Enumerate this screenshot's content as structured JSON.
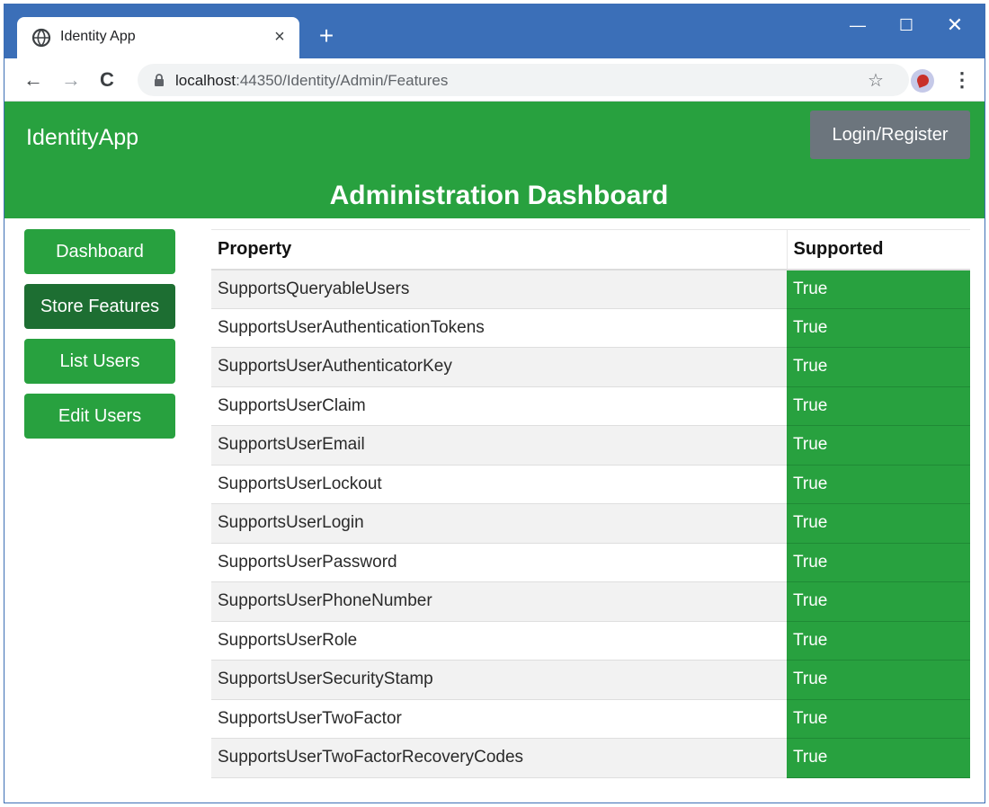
{
  "browser": {
    "tab_title": "Identity App",
    "tab_close": "×",
    "new_tab": "+",
    "controls": {
      "minimize": "—",
      "maximize": "☐",
      "close": "✕"
    },
    "nav": {
      "back": "←",
      "forward": "→",
      "reload": "C"
    },
    "url_host": "localhost",
    "url_path": ":44350/Identity/Admin/Features",
    "star": "☆",
    "menu": "⋮"
  },
  "app": {
    "brand": "IdentityApp",
    "login_label": "Login/Register",
    "title": "Administration Dashboard"
  },
  "sidebar": {
    "items": [
      {
        "label": "Dashboard",
        "active": false
      },
      {
        "label": "Store Features",
        "active": true
      },
      {
        "label": "List Users",
        "active": false
      },
      {
        "label": "Edit Users",
        "active": false
      }
    ]
  },
  "table": {
    "headers": [
      "Property",
      "Supported"
    ],
    "rows": [
      {
        "property": "SupportsQueryableUsers",
        "supported": "True"
      },
      {
        "property": "SupportsUserAuthenticationTokens",
        "supported": "True"
      },
      {
        "property": "SupportsUserAuthenticatorKey",
        "supported": "True"
      },
      {
        "property": "SupportsUserClaim",
        "supported": "True"
      },
      {
        "property": "SupportsUserEmail",
        "supported": "True"
      },
      {
        "property": "SupportsUserLockout",
        "supported": "True"
      },
      {
        "property": "SupportsUserLogin",
        "supported": "True"
      },
      {
        "property": "SupportsUserPassword",
        "supported": "True"
      },
      {
        "property": "SupportsUserPhoneNumber",
        "supported": "True"
      },
      {
        "property": "SupportsUserRole",
        "supported": "True"
      },
      {
        "property": "SupportsUserSecurityStamp",
        "supported": "True"
      },
      {
        "property": "SupportsUserTwoFactor",
        "supported": "True"
      },
      {
        "property": "SupportsUserTwoFactorRecoveryCodes",
        "supported": "True"
      }
    ]
  },
  "colors": {
    "brand_green": "#28a13f",
    "active_green": "#1d6e32",
    "login_gray": "#6c757d",
    "titlebar_blue": "#3b6fb8"
  },
  "icons": {
    "tab": "globe-icon",
    "lock": "lock-icon",
    "star": "star-icon",
    "profile": "profile-avatar-icon",
    "menu": "kebab-menu-icon"
  }
}
